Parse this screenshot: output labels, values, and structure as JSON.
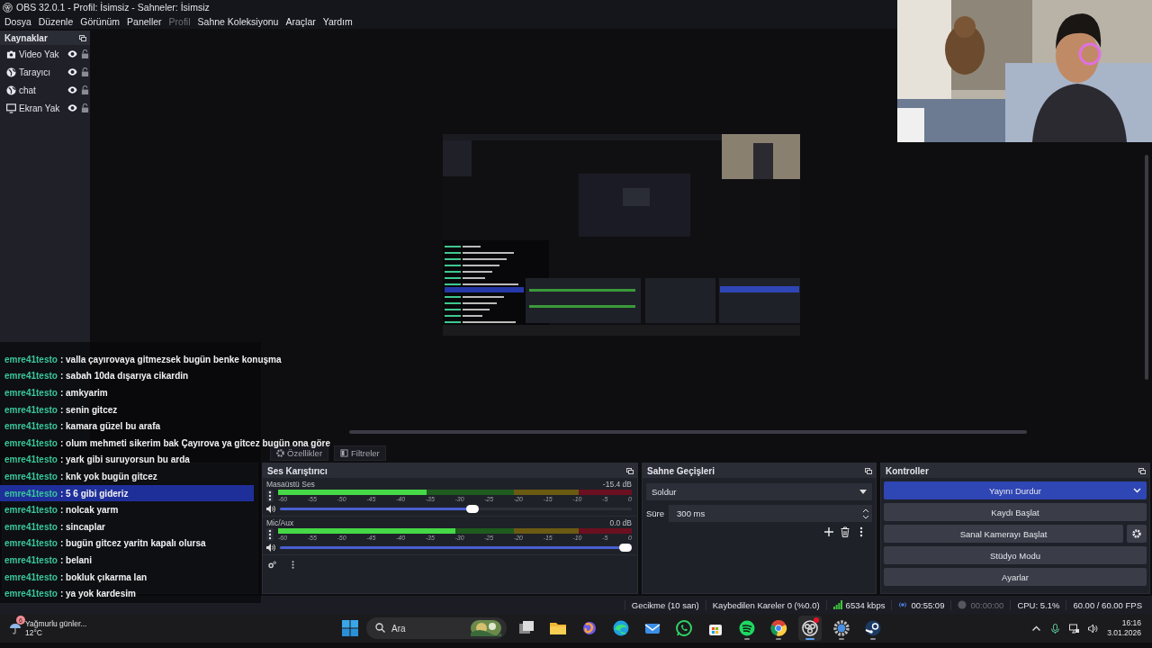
{
  "window": {
    "title": "OBS 32.0.1 - Profil: İsimsiz - Sahneler: İsimsiz"
  },
  "menu": [
    {
      "label": "Dosya",
      "disabled": false
    },
    {
      "label": "Düzenle",
      "disabled": false
    },
    {
      "label": "Görünüm",
      "disabled": false
    },
    {
      "label": "Paneller",
      "disabled": false
    },
    {
      "label": "Profil",
      "disabled": true
    },
    {
      "label": "Sahne Koleksiyonu",
      "disabled": false
    },
    {
      "label": "Araçlar",
      "disabled": false
    },
    {
      "label": "Yardım",
      "disabled": false
    }
  ],
  "sources": {
    "title": "Kaynaklar",
    "items": [
      {
        "name": "Video Yak",
        "kind": "camera",
        "visible": true,
        "locked": false
      },
      {
        "name": "Tarayıcı",
        "kind": "browser",
        "visible": true,
        "locked": false
      },
      {
        "name": "chat",
        "kind": "browser",
        "visible": true,
        "locked": false
      },
      {
        "name": "Ekran Yak",
        "kind": "display",
        "visible": true,
        "locked": false
      }
    ]
  },
  "toolbar": [
    {
      "label": "Özellikler",
      "kind": "properties"
    },
    {
      "label": "Filtreler",
      "kind": "filters"
    }
  ],
  "chat": [
    {
      "user": "emre41testo",
      "text": ": valla çayırovaya gitmezsek bugün benke konuşma",
      "highlighted": false
    },
    {
      "user": "emre41testo",
      "text": ": sabah 10da dışarıya cikardin",
      "highlighted": false
    },
    {
      "user": "emre41testo",
      "text": ": amkyarim",
      "highlighted": false
    },
    {
      "user": "emre41testo",
      "text": ": senin gitcez",
      "highlighted": false
    },
    {
      "user": "emre41testo",
      "text": ": kamara güzel bu arafa",
      "highlighted": false
    },
    {
      "user": "emre41testo",
      "text": ": olum mehmeti sikerim bak Çayırova ya gitcez bugün ona göre",
      "highlighted": false
    },
    {
      "user": "emre41testo",
      "text": ": yark gibi suruyorsun bu arda",
      "highlighted": false
    },
    {
      "user": "emre41testo",
      "text": ": knk yok bugün gitcez",
      "highlighted": false
    },
    {
      "user": "emre41testo",
      "text": ": 5 6 gibi gideriz",
      "highlighted": true
    },
    {
      "user": "emre41testo",
      "text": ": nolcak yarm",
      "highlighted": false
    },
    {
      "user": "emre41testo",
      "text": ": sincaplar",
      "highlighted": false
    },
    {
      "user": "emre41testo",
      "text": ": bugün gitcez yaritn kapalı olursa",
      "highlighted": false
    },
    {
      "user": "emre41testo",
      "text": ": belani",
      "highlighted": false
    },
    {
      "user": "emre41testo",
      "text": ": bokluk çıkarma lan",
      "highlighted": false
    },
    {
      "user": "emre41testo",
      "text": ": ya yok kardesim",
      "highlighted": false
    }
  ],
  "mixer": {
    "title": "Ses Karıştırıcı",
    "channels": [
      {
        "name": "Masaüstü Ses",
        "reading": "-15.4 dB",
        "meter": {
          "level": 0.42
        },
        "level": 0.55,
        "scale": [
          "-60",
          "-55",
          "-50",
          "-45",
          "-40",
          "-35",
          "-30",
          "-25",
          "-20",
          "-15",
          "-10",
          "-5",
          "0"
        ]
      },
      {
        "name": "Mic/Aux",
        "reading": "0.0 dB",
        "meter": {
          "level": 0.5
        },
        "level": 1.0,
        "scale": [
          "-60",
          "-55",
          "-50",
          "-45",
          "-40",
          "-35",
          "-30",
          "-25",
          "-20",
          "-15",
          "-10",
          "-5",
          "0"
        ]
      }
    ]
  },
  "transitions": {
    "title": "Sahne Geçişleri",
    "transition": "Soldur",
    "duration_label": "Süre",
    "duration": "300 ms"
  },
  "controls": {
    "title": "Kontroller",
    "buttons": [
      {
        "label": "Yayını Durdur",
        "active": true,
        "menu": true,
        "settings": false
      },
      {
        "label": "Kaydı Başlat",
        "active": false,
        "menu": false,
        "settings": false
      },
      {
        "label": "Sanal Kamerayı Başlat",
        "active": false,
        "menu": false,
        "settings": true
      },
      {
        "label": "Stüdyo Modu",
        "active": false,
        "menu": false,
        "settings": false
      },
      {
        "label": "Ayarlar",
        "active": false,
        "menu": false,
        "settings": false
      }
    ]
  },
  "status_bar": [
    {
      "text": "Gecikme (10 san)",
      "kind": "plain"
    },
    {
      "text": "Kaybedilen Kareler 0 (%0.0)",
      "kind": "plain"
    },
    {
      "text": "6534 kbps",
      "kind": "bitrate"
    },
    {
      "text": "00:55:09",
      "kind": "stream"
    },
    {
      "text": "00:00:00",
      "kind": "record"
    },
    {
      "text": "CPU: 5.1%",
      "kind": "plain"
    },
    {
      "text": "60.00 / 60.00 FPS",
      "kind": "plain"
    }
  ],
  "taskbar": {
    "weather": {
      "text": "Yağmurlu günler...",
      "temperature": "12°C",
      "badge": "6"
    },
    "search": {
      "placeholder": "Ara"
    },
    "apps": [
      {
        "kind": "taskview",
        "running": false,
        "active": false
      },
      {
        "kind": "folder",
        "running": false,
        "active": false
      },
      {
        "kind": "swirl",
        "running": false,
        "active": false
      },
      {
        "kind": "wave",
        "running": false,
        "active": false
      },
      {
        "kind": "mail",
        "running": false,
        "active": false
      },
      {
        "kind": "phone",
        "running": false,
        "active": false
      },
      {
        "kind": "bag",
        "running": false,
        "active": false
      },
      {
        "kind": "music",
        "running": true,
        "active": false
      },
      {
        "kind": "wheel",
        "running": true,
        "active": false
      },
      {
        "kind": "aperture",
        "running": true,
        "active": true
      },
      {
        "kind": "gear",
        "running": true,
        "active": false
      },
      {
        "kind": "steam",
        "running": true,
        "active": false
      }
    ],
    "time": "16:16",
    "date": "3.01.2026"
  }
}
